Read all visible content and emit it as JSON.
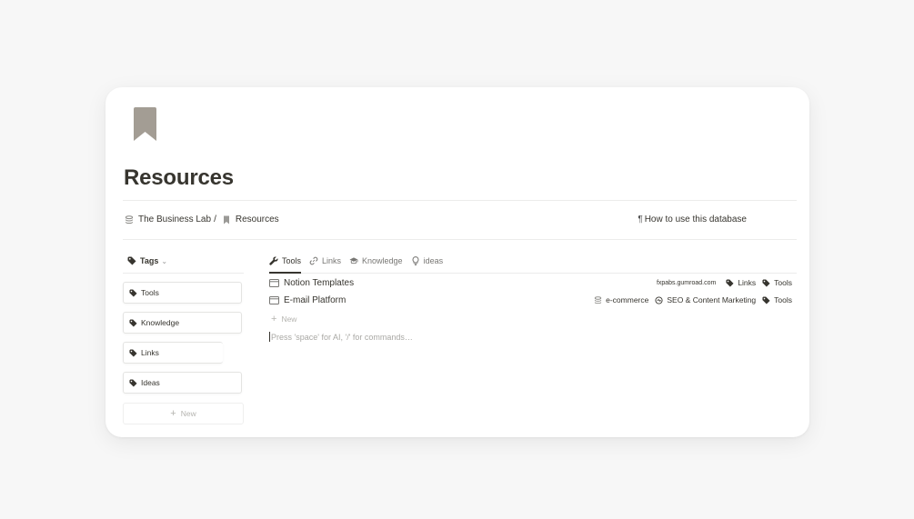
{
  "page": {
    "title": "Resources",
    "icon": "bookmark-icon"
  },
  "breadcrumb": {
    "parent": "The Business Lab",
    "separator": "/",
    "current": "Resources"
  },
  "how_to": {
    "symbol": "¶",
    "label": "How to use this database"
  },
  "sidebar": {
    "header": "Tags",
    "chevron": "⌄",
    "items": [
      {
        "label": "Tools"
      },
      {
        "label": "Knowledge"
      },
      {
        "label": "Links"
      },
      {
        "label": "Ideas"
      }
    ],
    "new_label": "New"
  },
  "tabs": [
    {
      "label": "Tools",
      "icon": "wrench-icon",
      "active": true
    },
    {
      "label": "Links",
      "icon": "link-icon",
      "active": false
    },
    {
      "label": "Knowledge",
      "icon": "graduation-cap-icon",
      "active": false
    },
    {
      "label": "ideas",
      "icon": "lightbulb-icon",
      "active": false
    }
  ],
  "rows": [
    {
      "title": "Notion Templates",
      "url": "fxpabs.gumroad.com",
      "tags": [
        "Links",
        "Tools"
      ]
    },
    {
      "title": "E-mail Platform",
      "category": "e-commerce",
      "topic": "SEO & Content Marketing",
      "tags": [
        "Tools"
      ]
    }
  ],
  "add_row_label": "New",
  "editor_hint": "Press 'space' for AI, '/' for commands…",
  "colors": {
    "icon_gray": "#9b9a97",
    "text": "#37352f",
    "muted": "#787774"
  }
}
